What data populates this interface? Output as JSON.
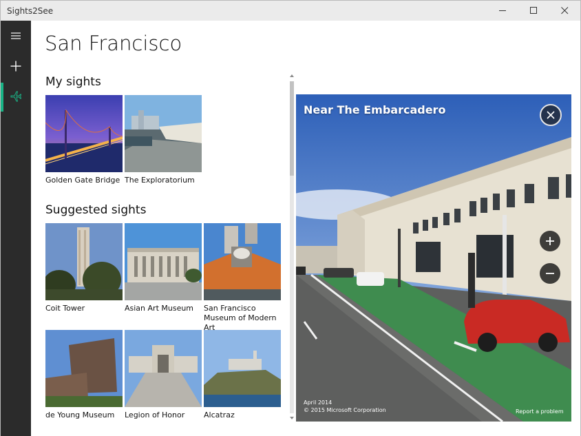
{
  "window": {
    "title": "Sights2See"
  },
  "rail": {
    "items": [
      {
        "icon": "hamburger-menu-icon"
      },
      {
        "icon": "add-icon"
      },
      {
        "icon": "airplane-icon",
        "selected": true
      }
    ],
    "accent": "#1ab386"
  },
  "page": {
    "title": "San Francisco"
  },
  "my_sights": {
    "title": "My sights",
    "items": [
      {
        "label": "Golden Gate Bridge"
      },
      {
        "label": "The Exploratorium"
      }
    ]
  },
  "suggested_sights": {
    "title": "Suggested sights",
    "items": [
      {
        "label": "Coit Tower"
      },
      {
        "label": "Asian Art Museum"
      },
      {
        "label": "San Francisco Museum of Modern Art"
      },
      {
        "label": "de Young Museum"
      },
      {
        "label": "Legion of Honor"
      },
      {
        "label": "Alcatraz"
      }
    ]
  },
  "detail": {
    "title": "Near The Embarcadero",
    "capture_date": "April 2014",
    "copyright": "© 2015 Microsoft Corporation",
    "report": "Report a problem"
  }
}
